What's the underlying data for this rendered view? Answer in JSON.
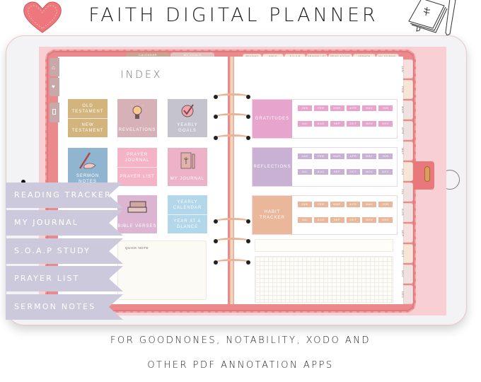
{
  "header": {
    "title": "FAITH DIGITAL PLANNER",
    "left_icon": "heart-icon",
    "right_icon": "journal-sketch-icon"
  },
  "planner": {
    "top_tabs_left": [
      "CALENDAR",
      "MY GOALS"
    ],
    "top_tabs_right": [
      "READING",
      "BIBLE VERSES",
      "S.O.A.P",
      "PRAYER LIST",
      "REVELATIONS",
      "SERMON",
      "MY JOURNAL"
    ],
    "side_nav_icons": [
      "home-icon",
      "heart-icon",
      "notebook-icon"
    ],
    "index": {
      "title": "INDEX",
      "tiles": [
        {
          "type": "split",
          "top": "OLD TESTAMENT",
          "bottom": "NEW TESTAMENT",
          "color": "#d2b47c"
        },
        {
          "type": "icon",
          "icon": "lightbulb-icon",
          "label": "REVELATIONS",
          "color": "#d6b2b8"
        },
        {
          "type": "icon",
          "icon": "checkmark-circle-icon",
          "label": "YEARLY GOALS",
          "color": "#c5c3ce"
        },
        {
          "type": "icon",
          "icon": "pen-hand-icon",
          "label": "SERMON NOTES",
          "color": "#8fb5d1"
        },
        {
          "type": "split",
          "top": "PRAYER JOURNAL",
          "bottom": "PRAYER LIST",
          "color": "#f4b3c7"
        },
        {
          "type": "icon",
          "icon": "journal-book-icon",
          "label": "MY JOURNAL",
          "color": "#eeb2c8"
        },
        {
          "type": "icon",
          "icon": "stacked-books-icon",
          "label": "BIBLE VERSES",
          "color": "#dcb5d3"
        },
        {
          "type": "split",
          "top": "YEARLY CALENDAR",
          "bottom": "YEAR AT A GLANCE",
          "color": "#b2d6ea"
        }
      ],
      "quick_note_label": "QUICK NOTE"
    },
    "trackers": [
      {
        "label": "GRATITUDES",
        "color": "#e7a4cd"
      },
      {
        "label": "REFLECTIONS",
        "color": "#c8b1d2"
      },
      {
        "label": "HABIT TRACKER",
        "color": "#ebb79b"
      }
    ],
    "months": [
      "JAN",
      "FEB",
      "MAR",
      "APR",
      "MAY",
      "JUN",
      "JUL",
      "AUG",
      "SEP",
      "OCT",
      "NOV",
      "DEC"
    ]
  },
  "ribbons": [
    "READING TRACKER",
    "MY JOURNAL",
    "S.O.A.P STUDY",
    "PRAYER LIST",
    "SERMON NOTES"
  ],
  "footer": {
    "line1": "FOR GOODNONES, NOTABILITY, XODO AND",
    "line2": "OTHER PDF ANNOTATION APPS"
  },
  "colors": {
    "cover": "#ea8a8d",
    "ribbon": "#cdc9dc",
    "screen_bg": "#f8cfd3"
  }
}
